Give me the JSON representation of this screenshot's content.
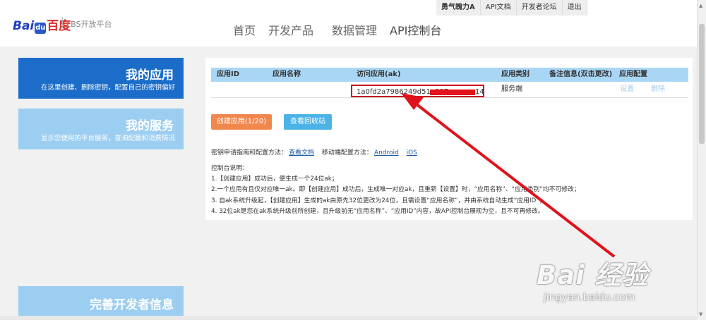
{
  "header": {
    "logo_a": "Bai",
    "logo_paw": "du",
    "logo_b": "百度",
    "brand": "LBS开放平台",
    "top_links": [
      "勇气魄力A",
      "API文档",
      "开发者论坛",
      "退出"
    ],
    "nav": [
      "首页",
      "开发产品",
      "数据管理",
      "API控制台"
    ]
  },
  "sidebar": {
    "items": [
      {
        "title": "我的应用",
        "desc": "在这里创建、删除密钥，配置自己的密钥偏好"
      },
      {
        "title": "我的服务",
        "desc": "显示您使用的平台服务，查询配额和消费情况"
      },
      {
        "title": "完善开发者信息",
        "desc": ""
      }
    ]
  },
  "table": {
    "columns": [
      "应用ID",
      "应用名称",
      "访问应用(ak)",
      "应用类别",
      "备注信息(双击更改)",
      "应用配置"
    ],
    "rows": [
      {
        "id": "",
        "name": "",
        "ak": "1a0fd2a7986249d51a997",
        "ak_tail": "14",
        "type": "服务端",
        "note": "",
        "config_set": "设置",
        "config_delete": "删除"
      }
    ]
  },
  "buttons": {
    "create": "创建应用(1/20)",
    "recycle": "查看回收站"
  },
  "guide": {
    "label": "密钥申请指南和配置方法：",
    "doc_link": "查看文档",
    "mobile_label": "移动端配置方法：",
    "android": "Android",
    "ios": "iOS"
  },
  "notes": {
    "title": "控制台说明：",
    "lines": [
      "1.【创建应用】成功后，便生成一个24位ak；",
      "2.一个应用有且仅对应唯一ak。即【创建应用】成功后，生成唯一对应ak，且重新【设置】时，“应用名称”、“应用类别”均不可修改；",
      "3. 自ak系统升级起，【创建应用】生成的ak由原先32位更改为24位，且需设置“应用名称”，并由系统自动生成“应用ID”；",
      "4. 32位ak是您在ak系统升级前所创建，且升级前无“应用名称”、“应用ID”内容，故API控制台展现为空，且不可再修改。"
    ]
  },
  "watermark": {
    "text": "Bai 经验",
    "url": "jingyan.baidu.com"
  },
  "colors": {
    "accent_blue": "#1c6dc9",
    "light_blue": "#9ccef1",
    "table_header": "#a9d6f5",
    "create_button": "#f2874e",
    "recycle_button": "#4bb3e7",
    "highlight_red": "#c4161c"
  }
}
